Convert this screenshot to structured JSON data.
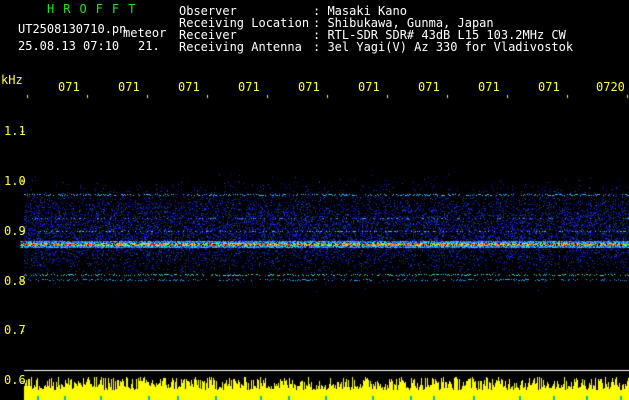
{
  "header": {
    "logo": "HROFFT",
    "filename": "UT2508130710.pn",
    "meteor_label": "meteor",
    "datetime": "25.08.13 07:10",
    "count": "21.",
    "info_rows": [
      {
        "label": "Observer",
        "value": ": Masaki Kano"
      },
      {
        "label": "Receiving Location",
        "value": ": Shibukawa, Gunma, Japan"
      },
      {
        "label": "Receiver",
        "value": ": RTL-SDR SDR# 43dB L15 103.2MHz CW"
      },
      {
        "label": "Receiving Antenna",
        "value": ": 3el Yagi(V) Az 330 for Vladivostok"
      }
    ]
  },
  "axis": {
    "unit": "kHz",
    "y_ticks": [
      {
        "label": "1.1",
        "value": 1.1
      },
      {
        "label": "1.0",
        "value": 1.0
      },
      {
        "label": "0.9",
        "value": 0.9
      },
      {
        "label": "0.8",
        "value": 0.8
      },
      {
        "label": "0.7",
        "value": 0.7
      },
      {
        "label": "0.6",
        "value": 0.6
      }
    ],
    "time_ticks": [
      "071",
      "071",
      "071",
      "071",
      "071",
      "071",
      "071",
      "071",
      "071",
      "0720"
    ]
  },
  "colors": {
    "logo": "#20e020",
    "labels": "#ffff30",
    "text": "#ffffff",
    "background": "#000000",
    "noise_blue": "#1030ff",
    "carrier_red": "#ff2020",
    "level_bars": "#ffff00"
  }
}
